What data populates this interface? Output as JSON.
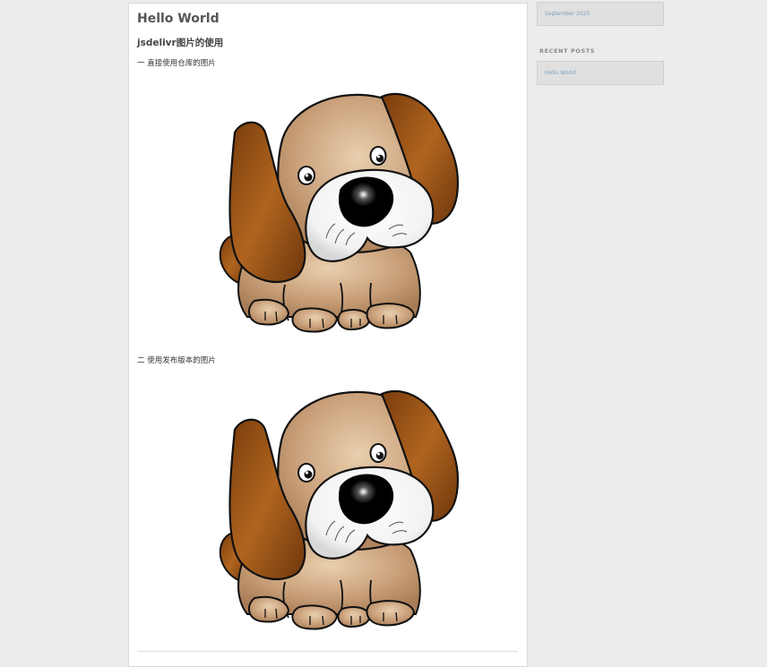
{
  "post": {
    "title": "Hello World",
    "subtitle": "jsdelivr图片的使用",
    "sections": [
      {
        "heading": "一 直接使用仓库的图片",
        "image": "puppy-illustration"
      },
      {
        "heading": "二 使用发布版本的图片",
        "image": "puppy-illustration"
      }
    ]
  },
  "sidebar": {
    "archive_link": "September 2020",
    "recent_posts_title": "RECENT POSTS",
    "recent_posts": [
      "Hello World"
    ]
  },
  "colors": {
    "page_background": "#ececec",
    "card_background": "#ffffff",
    "widget_background": "#e0e0e0",
    "link": "#7ea0bd",
    "dog_fur": "#c9a07a",
    "dog_ear": "#9b5516"
  }
}
